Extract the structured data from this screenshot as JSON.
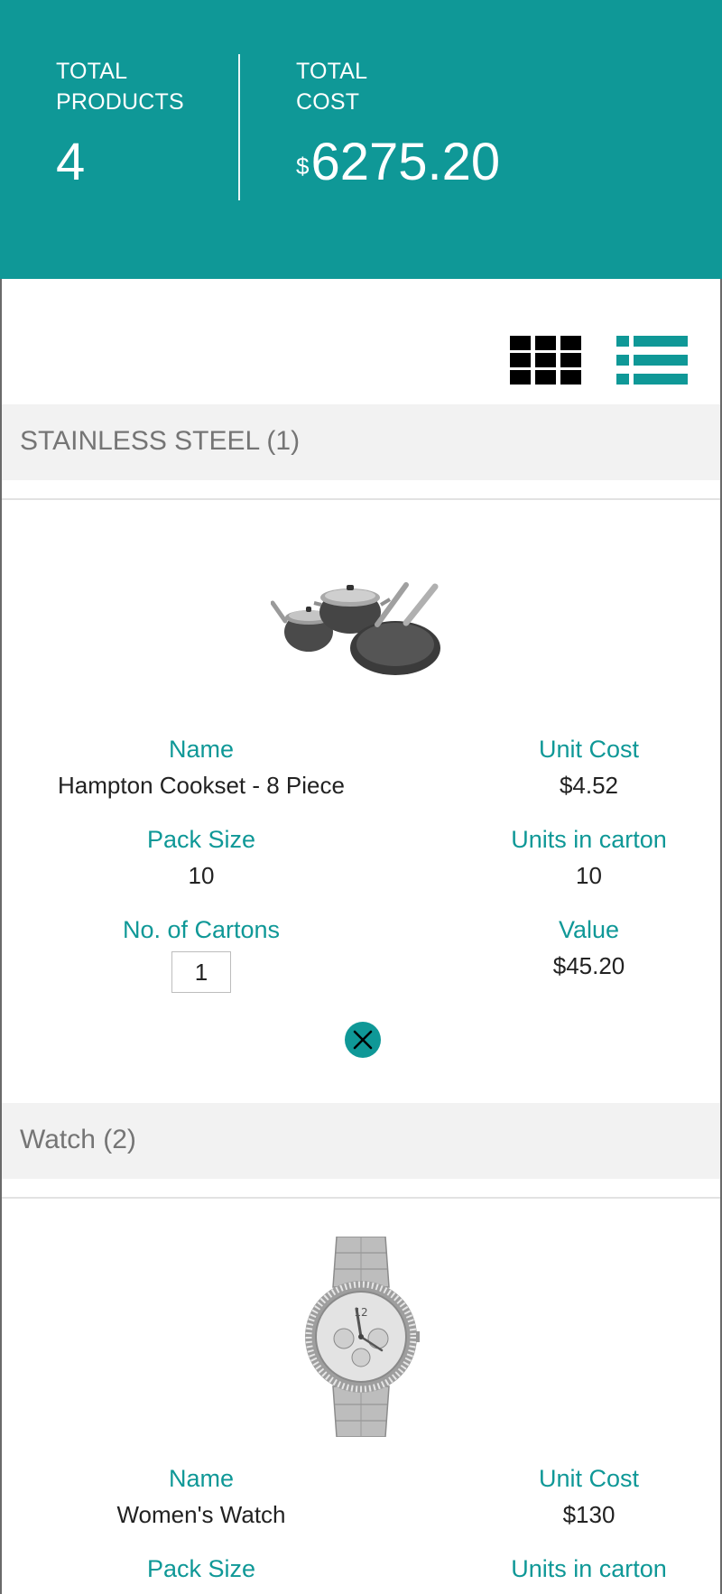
{
  "summary": {
    "products_label": "TOTAL PRODUCTS",
    "products_label_line1": "TOTAL",
    "products_label_line2": "PRODUCTS",
    "products_count": "4",
    "cost_label_line1": "TOTAL",
    "cost_label_line2": "COST",
    "cost_currency": "$",
    "cost_value": "6275.20"
  },
  "view_toggle": {
    "grid_icon": "grid-icon",
    "list_icon": "list-icon",
    "active": "list"
  },
  "groups": [
    {
      "title": "STAINLESS STEEL (1)",
      "products": [
        {
          "image_icon": "cookware-set-image",
          "labels": {
            "name": "Name",
            "unit_cost": "Unit Cost",
            "pack_size": "Pack Size",
            "units_in_carton": "Units in carton",
            "cartons": "No. of Cartons",
            "value": "Value"
          },
          "name": "Hampton Cookset - 8 Piece",
          "unit_cost": "$4.52",
          "pack_size": "10",
          "units_in_carton": "10",
          "cartons": "1",
          "value": "$45.20",
          "remove_icon": "close-circle-icon"
        }
      ]
    },
    {
      "title": "Watch (2)",
      "products": [
        {
          "image_icon": "watch-image",
          "labels": {
            "name": "Name",
            "unit_cost": "Unit Cost",
            "pack_size": "Pack Size",
            "units_in_carton": "Units in carton"
          },
          "name": "Women's Watch",
          "unit_cost": "$130"
        }
      ]
    }
  ],
  "colors": {
    "accent": "#0f9897",
    "group_bg": "#f2f2f2",
    "group_text": "#757575"
  }
}
